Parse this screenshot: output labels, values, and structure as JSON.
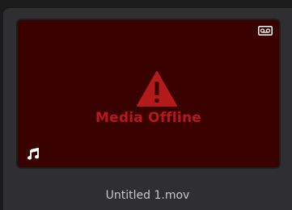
{
  "clip": {
    "name": "Untitled 1.mov",
    "status_text": "Media Offline",
    "icons": {
      "top_right": "tape-icon",
      "center": "warning-icon",
      "bottom_left": "audio-note-icon"
    },
    "colors": {
      "thumbnail_bg": "#3a0101",
      "warning_red": "#b51a1a",
      "card_bg": "#2f2f31"
    }
  }
}
